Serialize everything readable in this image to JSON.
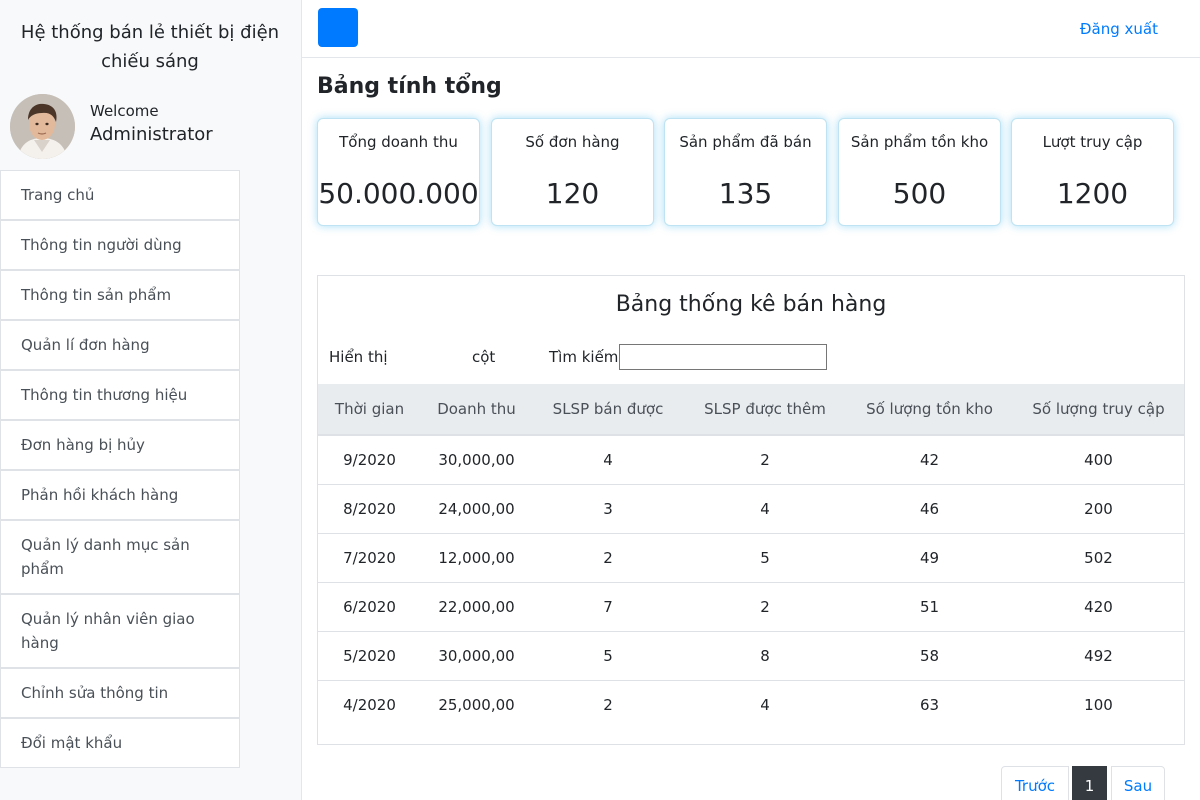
{
  "sidebar": {
    "brand": "Hệ thống bán lẻ thiết bị điện chiếu sáng",
    "welcome": "Welcome",
    "username": "Administrator",
    "items": [
      {
        "label": "Trang chủ"
      },
      {
        "label": "Thông tin người dùng"
      },
      {
        "label": "Thông tin sản phẩm"
      },
      {
        "label": "Quản lí đơn hàng"
      },
      {
        "label": "Thông tin thương hiệu"
      },
      {
        "label": "Đơn hàng bị hủy"
      },
      {
        "label": "Phản hồi khách hàng"
      },
      {
        "label": "Quản lý danh mục sản phẩm"
      },
      {
        "label": "Quản lý nhân viên giao hàng"
      },
      {
        "label": "Chỉnh sửa thông tin"
      },
      {
        "label": "Đổi mật khẩu"
      }
    ]
  },
  "topbar": {
    "logout": "Đăng xuất",
    "accent": "#007bff"
  },
  "summary": {
    "title": "Bảng tính tổng",
    "cards": [
      {
        "label": "Tổng doanh thu",
        "value": "50.000.000"
      },
      {
        "label": "Số đơn hàng",
        "value": "120"
      },
      {
        "label": "Sản phẩm đã bán",
        "value": "135"
      },
      {
        "label": "Sản phẩm tồn kho",
        "value": "500"
      },
      {
        "label": "Lượt truy cập",
        "value": "1200"
      }
    ]
  },
  "stats_table": {
    "title": "Bảng thống kê bán hàng",
    "show_label": "Hiển thị",
    "column_label": "cột",
    "search_label": "Tìm kiếm",
    "search_value": "",
    "columns": [
      "Thời gian",
      "Doanh thu",
      "SLSP  bán được",
      "SLSP  được thêm",
      "Số lượng tồn kho",
      "Số lượng truy cập"
    ],
    "rows": [
      [
        "9/2020",
        "30,000,00",
        "4",
        "2",
        "42",
        "400"
      ],
      [
        "8/2020",
        "24,000,00",
        "3",
        "4",
        "46",
        "200"
      ],
      [
        "7/2020",
        "12,000,00",
        "2",
        "5",
        "49",
        "502"
      ],
      [
        "6/2020",
        "22,000,00",
        "7",
        "2",
        "51",
        "420"
      ],
      [
        "5/2020",
        "30,000,00",
        "5",
        "8",
        "58",
        "492"
      ],
      [
        "4/2020",
        "25,000,00",
        "2",
        "4",
        "63",
        "100"
      ]
    ]
  },
  "pagination": {
    "prev": "Trước",
    "current": "1",
    "next": "Sau"
  }
}
